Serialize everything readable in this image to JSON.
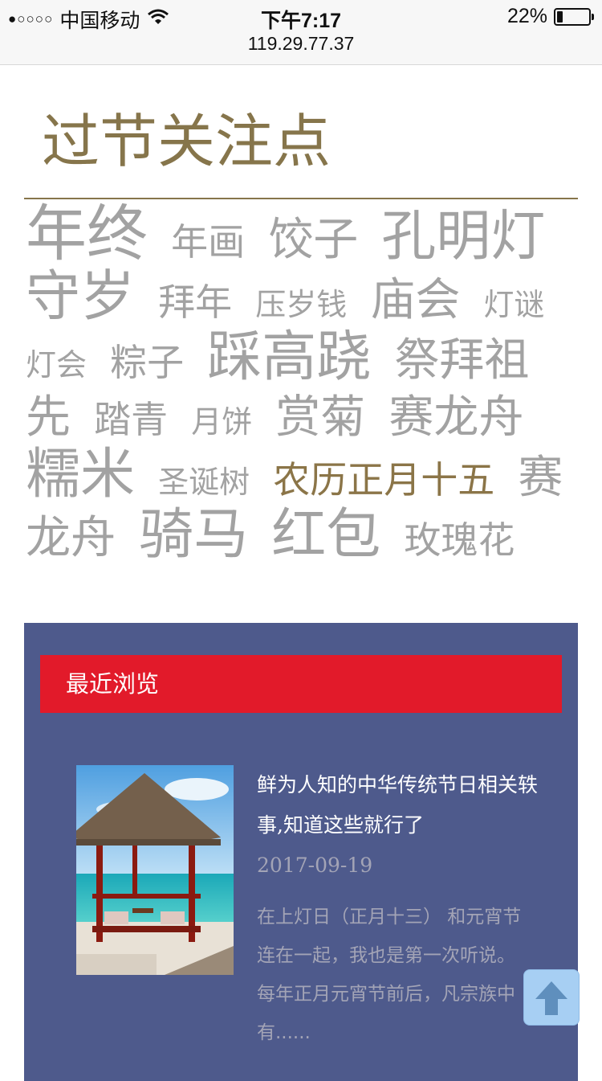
{
  "status_bar": {
    "signal": "●○○○○",
    "carrier": "中国移动",
    "time": "下午7:17",
    "url": "119.29.77.37",
    "battery_text": "22%",
    "battery_level": 0.22
  },
  "section": {
    "title": "过节关注点"
  },
  "tags": [
    {
      "label": "年终",
      "size": 5
    },
    {
      "label": "年画",
      "size": 2
    },
    {
      "label": "饺子",
      "size": 3
    },
    {
      "label": "孔明灯",
      "size": 4
    },
    {
      "label": "守岁",
      "size": 4
    },
    {
      "label": "拜年",
      "size": 2
    },
    {
      "label": "压岁钱",
      "size": 1
    },
    {
      "label": "庙会",
      "size": 3
    },
    {
      "label": "灯谜",
      "size": 1
    },
    {
      "label": "灯会",
      "size": 1
    },
    {
      "label": "粽子",
      "size": 2
    },
    {
      "label": "踩高跷",
      "size": 4
    },
    {
      "label": "祭拜祖先",
      "size": 3
    },
    {
      "label": "踏青",
      "size": 2
    },
    {
      "label": "月饼",
      "size": 1
    },
    {
      "label": "赏菊",
      "size": 3
    },
    {
      "label": "赛龙舟",
      "size": 3
    },
    {
      "label": "糯米",
      "size": 4
    },
    {
      "label": "圣诞树",
      "size": 1
    },
    {
      "label": "农历正月十五",
      "size": 2,
      "active": true
    },
    {
      "label": "赛龙舟",
      "size": 3
    },
    {
      "label": "骑马",
      "size": 4
    },
    {
      "label": "红包",
      "size": 4
    },
    {
      "label": "玫瑰花",
      "size": 2
    }
  ],
  "recent": {
    "header": "最近浏览",
    "articles": [
      {
        "title": "鲜为人知的中华传统节日相关轶事,知道这些就行了",
        "date": "2017-09-19",
        "summary": "在上灯日（正月十三） 和元宵节连在一起，我也是第一次听说。 每年正月元宵节前后，凡宗族中有......"
      }
    ]
  },
  "icons": {
    "wifi": "wifi-icon",
    "battery": "battery-icon",
    "back_to_top": "arrow-up-icon"
  },
  "colors": {
    "accent": "#86754b",
    "tag": "#a2a2a2",
    "panel": "#4e5a8c",
    "header_red": "#e21a2a",
    "back_top": "#a7cff3"
  }
}
